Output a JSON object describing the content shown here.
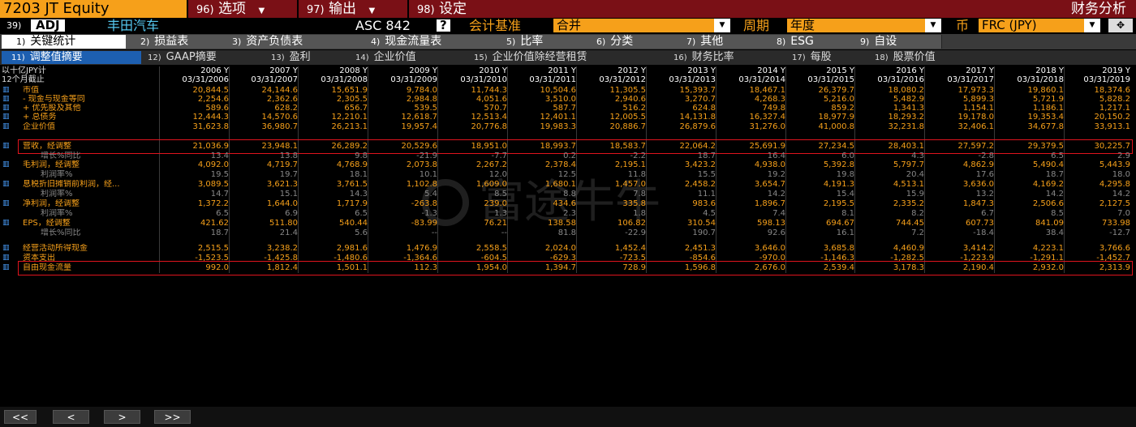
{
  "topbar": {
    "ticker": "7203 JT Equity",
    "menus": [
      {
        "num": "96)",
        "label": "选项",
        "caret": "▼"
      },
      {
        "num": "97)",
        "label": "输出",
        "caret": "▼"
      },
      {
        "num": "98)",
        "label": "设定",
        "caret": ""
      }
    ],
    "right_title": "财务分析"
  },
  "row2": {
    "num": "39)",
    "adj": "ADJ",
    "company": "丰田汽车",
    "standard": "ASC 842",
    "help": "?",
    "basis_label": "会计基准",
    "basis_value": "合并",
    "period_label": "周期",
    "period_value": "年度",
    "currency_label": "币",
    "currency_value": "FRC (JPY)",
    "dd_glyph": "▼"
  },
  "tabs_main": [
    {
      "num": "1)",
      "label": "关键统计"
    },
    {
      "num": "2)",
      "label": "损益表"
    },
    {
      "num": "3)",
      "label": "资产负债表"
    },
    {
      "num": "4)",
      "label": "现金流量表"
    },
    {
      "num": "5)",
      "label": "比率"
    },
    {
      "num": "6)",
      "label": "分类"
    },
    {
      "num": "7)",
      "label": "其他"
    },
    {
      "num": "8)",
      "label": "ESG"
    },
    {
      "num": "9)",
      "label": "自设"
    }
  ],
  "tabs_sub": [
    {
      "num": "11)",
      "label": "调整值摘要"
    },
    {
      "num": "12)",
      "label": "GAAP摘要"
    },
    {
      "num": "13)",
      "label": "盈利"
    },
    {
      "num": "14)",
      "label": "企业价值"
    },
    {
      "num": "15)",
      "label": "企业价值除经营租赁"
    },
    {
      "num": "16)",
      "label": "财务比率"
    },
    {
      "num": "17)",
      "label": "每股"
    },
    {
      "num": "18)",
      "label": "股票价值"
    }
  ],
  "table": {
    "unit_label": "以十亿JPY计",
    "period_label": "12个月截止",
    "years": [
      "2006 Y",
      "2007 Y",
      "2008 Y",
      "2009 Y",
      "2010 Y",
      "2011 Y",
      "2012 Y",
      "2013 Y",
      "2014 Y",
      "2015 Y",
      "2016 Y",
      "2017 Y",
      "2018 Y",
      "2019 Y"
    ],
    "dates": [
      "03/31/2006",
      "03/31/2007",
      "03/31/2008",
      "03/31/2009",
      "03/31/2010",
      "03/31/2011",
      "03/31/2012",
      "03/31/2013",
      "03/31/2014",
      "03/31/2015",
      "03/31/2016",
      "03/31/2017",
      "03/31/2018",
      "03/31/2019"
    ],
    "rows": [
      {
        "label": "市值",
        "style": "main",
        "vals": [
          "20,844.5",
          "24,144.6",
          "15,651.9",
          "9,784.0",
          "11,744.3",
          "10,504.6",
          "11,305.5",
          "15,393.7",
          "18,467.1",
          "26,379.7",
          "18,080.2",
          "17,973.3",
          "19,860.1",
          "18,374.6"
        ]
      },
      {
        "label": "- 现金与现金等同",
        "style": "main",
        "vals": [
          "2,254.6",
          "2,362.6",
          "2,305.5",
          "2,984.8",
          "4,051.6",
          "3,510.0",
          "2,940.6",
          "3,270.7",
          "4,268.3",
          "5,216.0",
          "5,482.9",
          "5,899.3",
          "5,721.9",
          "5,828.2"
        ]
      },
      {
        "label": "+ 优先股及其他",
        "style": "main",
        "vals": [
          "589.6",
          "628.2",
          "656.7",
          "539.5",
          "570.7",
          "587.7",
          "516.2",
          "624.8",
          "749.8",
          "859.2",
          "1,341.3",
          "1,154.1",
          "1,186.1",
          "1,217.1"
        ]
      },
      {
        "label": "+ 总债务",
        "style": "main",
        "vals": [
          "12,444.3",
          "14,570.6",
          "12,210.1",
          "12,618.7",
          "12,513.4",
          "12,401.1",
          "12,005.5",
          "14,131.8",
          "16,327.4",
          "18,977.9",
          "18,293.2",
          "19,178.0",
          "19,353.4",
          "20,150.2"
        ]
      },
      {
        "label": "企业价值",
        "style": "main",
        "vals": [
          "31,623.8",
          "36,980.7",
          "26,213.1",
          "19,957.4",
          "20,776.8",
          "19,983.3",
          "20,886.7",
          "26,879.6",
          "31,276.0",
          "41,000.8",
          "32,231.8",
          "32,406.1",
          "34,677.8",
          "33,913.1"
        ]
      },
      {
        "label": "营收，经调整",
        "style": "main",
        "vals": [
          "21,036.9",
          "23,948.1",
          "26,289.2",
          "20,529.6",
          "18,951.0",
          "18,993.7",
          "18,583.7",
          "22,064.2",
          "25,691.9",
          "27,234.5",
          "28,403.1",
          "27,597.2",
          "29,379.5",
          "30,225.7"
        ]
      },
      {
        "label": "增长%同比",
        "style": "sub",
        "vals": [
          "13.4",
          "13.8",
          "9.8",
          "-21.9",
          "-7.7",
          "0.2",
          "-2.2",
          "18.7",
          "16.4",
          "6.0",
          "4.3",
          "-2.8",
          "6.5",
          "2.9"
        ]
      },
      {
        "label": "毛利润，经调整",
        "style": "main",
        "vals": [
          "4,092.0",
          "4,719.7",
          "4,768.9",
          "2,073.8",
          "2,267.2",
          "2,378.4",
          "2,195.1",
          "3,423.2",
          "4,938.0",
          "5,392.8",
          "5,797.7",
          "4,862.9",
          "5,490.4",
          "5,443.9"
        ]
      },
      {
        "label": "利润率%",
        "style": "sub",
        "vals": [
          "19.5",
          "19.7",
          "18.1",
          "10.1",
          "12.0",
          "12.5",
          "11.8",
          "15.5",
          "19.2",
          "19.8",
          "20.4",
          "17.6",
          "18.7",
          "18.0"
        ]
      },
      {
        "label": "息税折旧摊销前利润，经...",
        "style": "main",
        "vals": [
          "3,089.5",
          "3,621.3",
          "3,761.5",
          "1,102.8",
          "1,609.0",
          "1,680.1",
          "1,457.0",
          "2,458.2",
          "3,654.7",
          "4,191.3",
          "4,513.1",
          "3,636.0",
          "4,169.2",
          "4,295.8"
        ]
      },
      {
        "label": "利润率%",
        "style": "sub",
        "vals": [
          "14.7",
          "15.1",
          "14.3",
          "5.4",
          "8.5",
          "8.8",
          "7.8",
          "11.1",
          "14.2",
          "15.4",
          "15.9",
          "13.2",
          "14.2",
          "14.2"
        ]
      },
      {
        "label": "净利润，经调整",
        "style": "main",
        "vals": [
          "1,372.2",
          "1,644.0",
          "1,717.9",
          "-263.8",
          "239.0",
          "434.6",
          "335.8",
          "983.6",
          "1,896.7",
          "2,195.5",
          "2,335.2",
          "1,847.3",
          "2,506.6",
          "2,127.5"
        ]
      },
      {
        "label": "利润率%",
        "style": "sub",
        "vals": [
          "6.5",
          "6.9",
          "6.5",
          "-1.3",
          "1.3",
          "2.3",
          "1.8",
          "4.5",
          "7.4",
          "8.1",
          "8.2",
          "6.7",
          "8.5",
          "7.0"
        ]
      },
      {
        "label": "EPS，经调整",
        "style": "main",
        "vals": [
          "421.62",
          "511.80",
          "540.44",
          "-83.99",
          "76.21",
          "138.58",
          "106.82",
          "310.54",
          "598.13",
          "694.67",
          "744.45",
          "607.73",
          "841.09",
          "733.98"
        ]
      },
      {
        "label": "增长%同比",
        "style": "sub",
        "vals": [
          "18.7",
          "21.4",
          "5.6",
          "--",
          "--",
          "81.8",
          "-22.9",
          "190.7",
          "92.6",
          "16.1",
          "7.2",
          "-18.4",
          "38.4",
          "-12.7"
        ]
      },
      {
        "label": "经营活动所得现金",
        "style": "main",
        "vals": [
          "2,515.5",
          "3,238.2",
          "2,981.6",
          "1,476.9",
          "2,558.5",
          "2,024.0",
          "1,452.4",
          "2,451.3",
          "3,646.0",
          "3,685.8",
          "4,460.9",
          "3,414.2",
          "4,223.1",
          "3,766.6"
        ]
      },
      {
        "label": "资本支出",
        "style": "main",
        "vals": [
          "-1,523.5",
          "-1,425.8",
          "-1,480.6",
          "-1,364.6",
          "-604.5",
          "-629.3",
          "-723.5",
          "-854.6",
          "-970.0",
          "-1,146.3",
          "-1,282.5",
          "-1,223.9",
          "-1,291.1",
          "-1,452.7"
        ]
      },
      {
        "label": "自由现金流量",
        "style": "main",
        "vals": [
          "992.0",
          "1,812.4",
          "1,501.1",
          "112.3",
          "1,954.0",
          "1,394.7",
          "728.9",
          "1,596.8",
          "2,676.0",
          "2,539.4",
          "3,178.3",
          "2,190.4",
          "2,932.0",
          "2,313.9"
        ]
      }
    ]
  },
  "watermark": "富途牛牛",
  "nav": [
    "<<",
    "<",
    ">",
    ">>"
  ],
  "colors": {
    "orange": "#f6a01a",
    "dark_red": "#7a1016",
    "highlight": "#e0141e",
    "active_blue": "#1d5fb0"
  }
}
